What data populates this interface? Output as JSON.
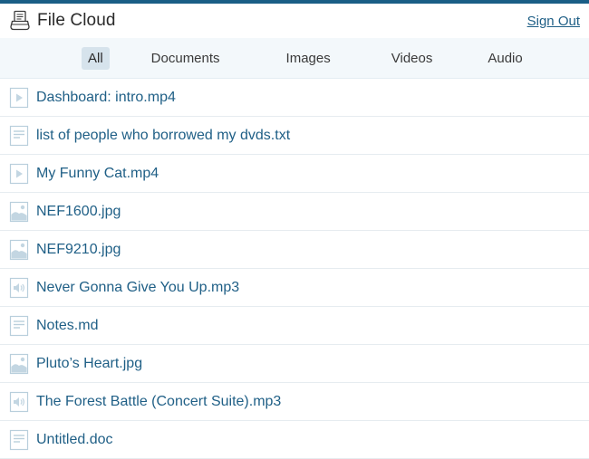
{
  "app": {
    "title": "File Cloud",
    "sign_out_label": "Sign Out"
  },
  "tabs": [
    {
      "label": "All",
      "active": true
    },
    {
      "label": "Documents",
      "active": false
    },
    {
      "label": "Images",
      "active": false
    },
    {
      "label": "Videos",
      "active": false
    },
    {
      "label": "Audio",
      "active": false
    }
  ],
  "files": [
    {
      "name": "Dashboard: intro.mp4",
      "icon": "video-file-icon"
    },
    {
      "name": "list of people who borrowed my dvds.txt",
      "icon": "document-file-icon"
    },
    {
      "name": "My Funny Cat.mp4",
      "icon": "video-file-icon"
    },
    {
      "name": "NEF1600.jpg",
      "icon": "image-file-icon"
    },
    {
      "name": "NEF9210.jpg",
      "icon": "image-file-icon"
    },
    {
      "name": "Never Gonna Give You Up.mp3",
      "icon": "audio-file-icon"
    },
    {
      "name": "Notes.md",
      "icon": "document-file-icon"
    },
    {
      "name": "Pluto’s Heart.jpg",
      "icon": "image-file-icon"
    },
    {
      "name": "The Forest Battle (Concert Suite).mp3",
      "icon": "audio-file-icon"
    },
    {
      "name": "Untitled.doc",
      "icon": "document-file-icon"
    }
  ],
  "colors": {
    "accent": "#1a5e86",
    "link": "#1f5f86",
    "tab_bar_bg": "#f3f8fb",
    "active_tab_bg": "#d6e3ec",
    "icon_fill": "#d7e6ee"
  }
}
